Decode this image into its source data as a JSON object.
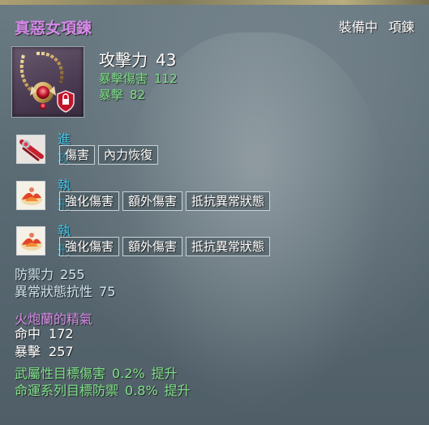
{
  "item": {
    "name": "真惡女項鍊",
    "status": "裝備中",
    "slot": "項鍊",
    "icon": "necklace-icon"
  },
  "main_stat": {
    "label": "攻擊力",
    "value": "43"
  },
  "sub_stats": [
    {
      "label": "暴擊傷害",
      "value": "112"
    },
    {
      "label": "暴擊",
      "value": "82"
    }
  ],
  "effects": [
    {
      "name": "進攻",
      "icon": "claw-skill-icon",
      "tags": [
        "傷害",
        "內力恢復"
      ]
    },
    {
      "name": "執刑",
      "icon": "flame-skill-icon",
      "tags": [
        "強化傷害",
        "額外傷害",
        "抵抗異常狀態"
      ]
    },
    {
      "name": "執刑",
      "icon": "flame-skill-icon",
      "tags": [
        "強化傷害",
        "額外傷害",
        "抵抗異常狀態"
      ]
    }
  ],
  "defense": [
    {
      "label": "防禦力",
      "value": "255"
    },
    {
      "label": "異常狀態抗性",
      "value": "75"
    }
  ],
  "gem": {
    "title": "火炮蘭的精氣",
    "stats": [
      {
        "label": "命中",
        "value": "172"
      },
      {
        "label": "暴擊",
        "value": "257"
      }
    ]
  },
  "bonuses": [
    {
      "label": "武屬性目標傷害",
      "value": "0.2%",
      "state": "提升"
    },
    {
      "label": "命運系列目標防禦",
      "value": "0.8%",
      "state": "提升"
    }
  ],
  "colors": {
    "title": "#d58ae8",
    "green": "#7fe08a",
    "effect_name": "#42c6e8"
  }
}
